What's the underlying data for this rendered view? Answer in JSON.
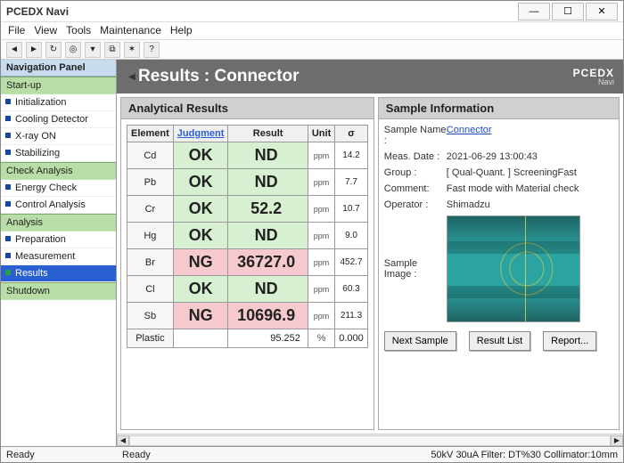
{
  "window": {
    "title": "PCEDX Navi"
  },
  "window_controls": {
    "min": "—",
    "max": "☐",
    "close": "✕"
  },
  "menu": [
    "File",
    "View",
    "Tools",
    "Maintenance",
    "Help"
  ],
  "toolbar_icons": [
    "back-icon",
    "forward-icon",
    "refresh-icon",
    "target-icon",
    "filter-icon",
    "copy-icon",
    "encrypt-icon",
    "help-icon"
  ],
  "nav": {
    "header": "Navigation Panel",
    "groups": [
      {
        "label": "Start-up",
        "items": [
          "Initialization",
          "Cooling Detector",
          "X-ray ON",
          "Stabilizing"
        ]
      },
      {
        "label": "Check Analysis",
        "items": [
          "Energy Check",
          "Control Analysis"
        ]
      },
      {
        "label": "Analysis",
        "items": [
          "Preparation",
          "Measurement",
          "Results"
        ],
        "selected_index": 2,
        "green_index": 2
      },
      {
        "label": "Shutdown",
        "items": []
      }
    ]
  },
  "header": {
    "title": "Results : Connector",
    "brand1": "PCEDX",
    "brand2": "Navi"
  },
  "results": {
    "title": "Analytical Results",
    "cols": [
      "Element",
      "Judgment",
      "Result",
      "Unit",
      "σ"
    ],
    "rows": [
      {
        "el": "Cd",
        "jd": "OK",
        "res": "ND",
        "unit": "ppm",
        "sig": "14.2",
        "cls": "ok"
      },
      {
        "el": "Pb",
        "jd": "OK",
        "res": "ND",
        "unit": "ppm",
        "sig": "7.7",
        "cls": "ok"
      },
      {
        "el": "Cr",
        "jd": "OK",
        "res": "52.2",
        "unit": "ppm",
        "sig": "10.7",
        "cls": "ok"
      },
      {
        "el": "Hg",
        "jd": "OK",
        "res": "ND",
        "unit": "ppm",
        "sig": "9.0",
        "cls": "ok"
      },
      {
        "el": "Br",
        "jd": "NG",
        "res": "36727.0",
        "unit": "ppm",
        "sig": "452.7",
        "cls": "ng"
      },
      {
        "el": "Cl",
        "jd": "OK",
        "res": "ND",
        "unit": "ppm",
        "sig": "60.3",
        "cls": "ok"
      },
      {
        "el": "Sb",
        "jd": "NG",
        "res": "10696.9",
        "unit": "ppm",
        "sig": "211.3",
        "cls": "ng"
      }
    ],
    "plastic": {
      "el": "Plastic",
      "res": "95.252",
      "unit": "%",
      "sig": "0.000"
    }
  },
  "sample": {
    "title": "Sample Information",
    "fields": {
      "name_label": "Sample Name :",
      "name_value": "Connector",
      "date_label": "Meas. Date :",
      "date_value": "2021-06-29 13:00:43",
      "group_label": "Group :",
      "group_value": "[ Qual-Quant. ] ScreeningFast",
      "comment_label": "Comment:",
      "comment_value": "Fast mode with Material check",
      "operator_label": "Operator :",
      "operator_value": "Shimadzu",
      "image_label": "Sample Image :"
    },
    "buttons": {
      "next": "Next Sample",
      "list": "Result List",
      "report": "Report..."
    }
  },
  "status": {
    "readyL": "Ready",
    "readyC": "Ready",
    "kv": "50kV  30uA  Filter: DT%30 Collimator:10mm"
  }
}
